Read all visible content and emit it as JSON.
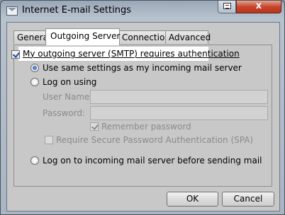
{
  "window": {
    "title": "Internet E-mail Settings",
    "close_label": "x",
    "icons": {
      "app": "envelope-icon",
      "help": "help-window-icon"
    }
  },
  "tabs": [
    {
      "label": "General",
      "selected": false
    },
    {
      "label": "Outgoing Server",
      "selected": true
    },
    {
      "label": "Connection",
      "selected": false
    },
    {
      "label": "Advanced",
      "selected": false
    }
  ],
  "smtp_auth": {
    "label": "My outgoing server (SMTP) requires authentication",
    "checked": true
  },
  "options": {
    "same_settings": {
      "label": "Use same settings as my incoming mail server",
      "selected": true
    },
    "log_on_using": {
      "label": "Log on using",
      "selected": false
    },
    "user_name": {
      "label": "User Name:",
      "value": ""
    },
    "password": {
      "label": "Password:",
      "value": ""
    },
    "remember_password": {
      "label": "Remember password",
      "checked": true,
      "enabled": false
    },
    "spa": {
      "label": "Require Secure Password Authentication (SPA)",
      "checked": false,
      "enabled": false
    },
    "log_on_incoming": {
      "label": "Log on to incoming mail server before sending mail",
      "selected": false
    }
  },
  "buttons": {
    "ok": "OK",
    "cancel": "Cancel"
  }
}
